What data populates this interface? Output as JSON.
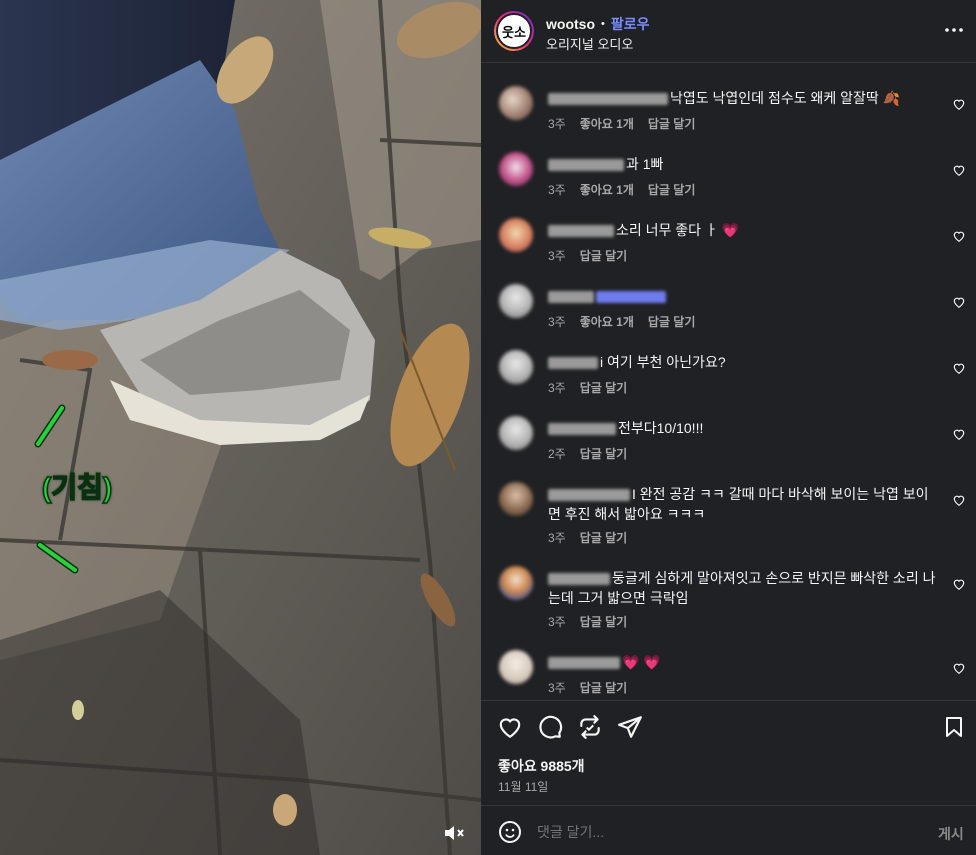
{
  "post": {
    "username": "wootso",
    "separator": "•",
    "follow_label": "팔로우",
    "audio_label": "오리지널 오디오",
    "avatar_text": "웃소",
    "overlay_text": "(기침)"
  },
  "comments": [
    {
      "text": "낙엽도 낙엽인데 점수도 왜케 알잘딱",
      "emoji": "🍂",
      "time": "3주",
      "likes": "좋아요 1개",
      "reply": "답글 달기"
    },
    {
      "text": "과 1빠",
      "time": "3주",
      "likes": "좋아요 1개",
      "reply": "답글 달기"
    },
    {
      "text": "소리 너무 좋다 ㅏ",
      "emoji": "💗",
      "time": "3주",
      "reply": "답글 달기"
    },
    {
      "text": "",
      "time": "3주",
      "likes": "좋아요 1개",
      "reply": "답글 달기"
    },
    {
      "text": "i 여기 부천 아닌가요?",
      "time": "3주",
      "reply": "답글 달기"
    },
    {
      "text": "전부다10/10!!!",
      "time": "2주",
      "reply": "답글 달기"
    },
    {
      "text": "I 완전 공감 ㅋㅋ 갈때 마다 바삭해 보이는 낙엽 보이면 후진 해서 밟아요 ㅋㅋㅋ",
      "time": "3주",
      "reply": "답글 달기"
    },
    {
      "text": "둥글게 심하게 말아져잇고 손으로 반지믄 빠삭한 소리 나는데 그거 밟으면 극락임",
      "time": "3주",
      "reply": "답글 달기"
    },
    {
      "text": "",
      "emoji": "💗 💗",
      "time": "3주",
      "reply": "답글 달기"
    }
  ],
  "footer": {
    "likes_count": "좋아요 9885개",
    "date": "11월 11일",
    "comment_placeholder": "댓글 달기...",
    "post_button": "게시"
  },
  "icons": [
    "like-icon",
    "comment-icon",
    "repost-icon",
    "share-icon",
    "save-icon",
    "mute-icon",
    "more-icon",
    "emoji-icon"
  ],
  "colors": {
    "panel_bg": "#202124",
    "follow": "#7b8cff",
    "overlay_text": "#28d13c",
    "heart": "#ff3b5c"
  }
}
